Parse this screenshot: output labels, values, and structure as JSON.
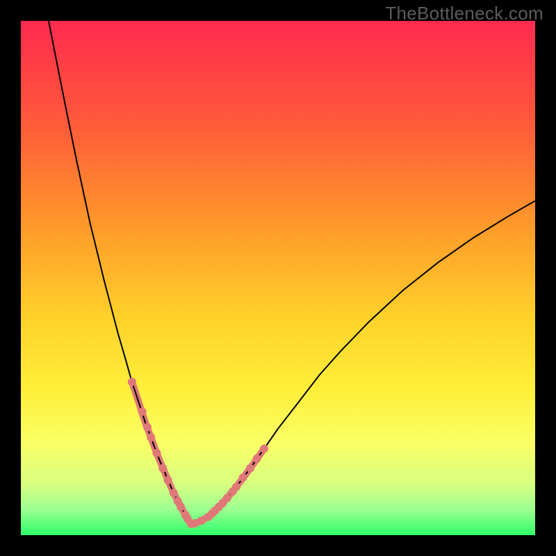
{
  "watermark": "TheBottleneck.com",
  "chart_data": {
    "type": "line",
    "title": "",
    "xlabel": "",
    "ylabel": "",
    "xlim": [
      0,
      100
    ],
    "ylim": [
      0,
      100
    ],
    "grid": false,
    "legend": false,
    "background_gradient": {
      "stops": [
        {
          "offset": 0.0,
          "color": "#ff2a4f"
        },
        {
          "offset": 0.2,
          "color": "#ff5a3a"
        },
        {
          "offset": 0.4,
          "color": "#ff9a2a"
        },
        {
          "offset": 0.58,
          "color": "#ffd22a"
        },
        {
          "offset": 0.72,
          "color": "#ffef3a"
        },
        {
          "offset": 0.82,
          "color": "#fbff66"
        },
        {
          "offset": 0.9,
          "color": "#d8ff80"
        },
        {
          "offset": 0.95,
          "color": "#9cff90"
        },
        {
          "offset": 1.0,
          "color": "#2eff6a"
        }
      ]
    },
    "series": [
      {
        "name": "left-branch",
        "color": "#000000",
        "stroke_width": 2,
        "x": [
          5.4,
          8.1,
          10.8,
          13.5,
          16.2,
          18.9,
          20.3,
          21.6,
          23.0,
          24.3,
          25.3,
          26.4,
          27.0,
          28.4,
          29.7,
          31.1,
          32.4,
          33.1
        ],
        "y": [
          100.0,
          86.3,
          73.0,
          60.5,
          49.5,
          39.2,
          34.4,
          29.8,
          25.6,
          21.6,
          19.0,
          16.0,
          14.5,
          11.2,
          8.2,
          5.5,
          3.2,
          2.2
        ]
      },
      {
        "name": "right-branch",
        "color": "#000000",
        "stroke_width": 2,
        "x": [
          33.1,
          33.8,
          35.1,
          36.5,
          37.8,
          39.2,
          40.5,
          41.9,
          44.6,
          47.3,
          50.0,
          54.1,
          58.1,
          62.2,
          67.6,
          74.3,
          81.1,
          87.8,
          94.6,
          100.0
        ],
        "y": [
          2.2,
          2.3,
          2.8,
          3.6,
          4.8,
          6.2,
          7.7,
          9.4,
          13.0,
          16.8,
          20.7,
          26.0,
          31.2,
          35.8,
          41.4,
          47.6,
          53.0,
          57.7,
          61.9,
          65.0
        ]
      }
    ],
    "highlighted_segments": [
      {
        "name": "left-highlight",
        "color": "#e07878",
        "stroke_width": 10,
        "x": [
          21.6,
          23.0,
          24.3,
          25.3,
          26.4,
          27.0,
          28.4,
          29.7,
          31.1,
          32.4,
          33.1
        ],
        "y": [
          29.8,
          25.6,
          21.6,
          19.0,
          16.0,
          14.5,
          11.2,
          8.2,
          5.5,
          3.2,
          2.2
        ]
      },
      {
        "name": "right-highlight",
        "color": "#e07878",
        "stroke_width": 10,
        "x": [
          33.1,
          33.8,
          35.1,
          36.5,
          37.8,
          39.2,
          40.5,
          41.9,
          44.6,
          47.3
        ],
        "y": [
          2.2,
          2.3,
          2.8,
          3.6,
          4.8,
          6.2,
          7.7,
          9.4,
          13.0,
          16.8
        ]
      }
    ],
    "highlighted_points": [
      {
        "x": 21.6,
        "y": 29.8
      },
      {
        "x": 23.6,
        "y": 24.0
      },
      {
        "x": 24.6,
        "y": 21.0
      },
      {
        "x": 25.3,
        "y": 19.0
      },
      {
        "x": 26.4,
        "y": 16.0
      },
      {
        "x": 27.6,
        "y": 13.0
      },
      {
        "x": 28.6,
        "y": 10.7
      },
      {
        "x": 29.7,
        "y": 8.2
      },
      {
        "x": 30.5,
        "y": 6.6
      },
      {
        "x": 31.1,
        "y": 5.5
      },
      {
        "x": 32.0,
        "y": 3.9
      },
      {
        "x": 32.4,
        "y": 3.2
      },
      {
        "x": 33.1,
        "y": 2.2
      },
      {
        "x": 33.8,
        "y": 2.3
      },
      {
        "x": 35.1,
        "y": 2.8
      },
      {
        "x": 36.5,
        "y": 3.6
      },
      {
        "x": 37.2,
        "y": 4.2
      },
      {
        "x": 37.8,
        "y": 4.8
      },
      {
        "x": 38.5,
        "y": 5.5
      },
      {
        "x": 39.2,
        "y": 6.2
      },
      {
        "x": 40.1,
        "y": 7.2
      },
      {
        "x": 41.2,
        "y": 8.5
      },
      {
        "x": 41.9,
        "y": 9.4
      },
      {
        "x": 43.2,
        "y": 11.2
      },
      {
        "x": 44.6,
        "y": 13.0
      },
      {
        "x": 45.9,
        "y": 14.9
      },
      {
        "x": 47.3,
        "y": 16.8
      }
    ],
    "highlight_point_color": "#e07878",
    "highlight_point_radius": 6
  }
}
